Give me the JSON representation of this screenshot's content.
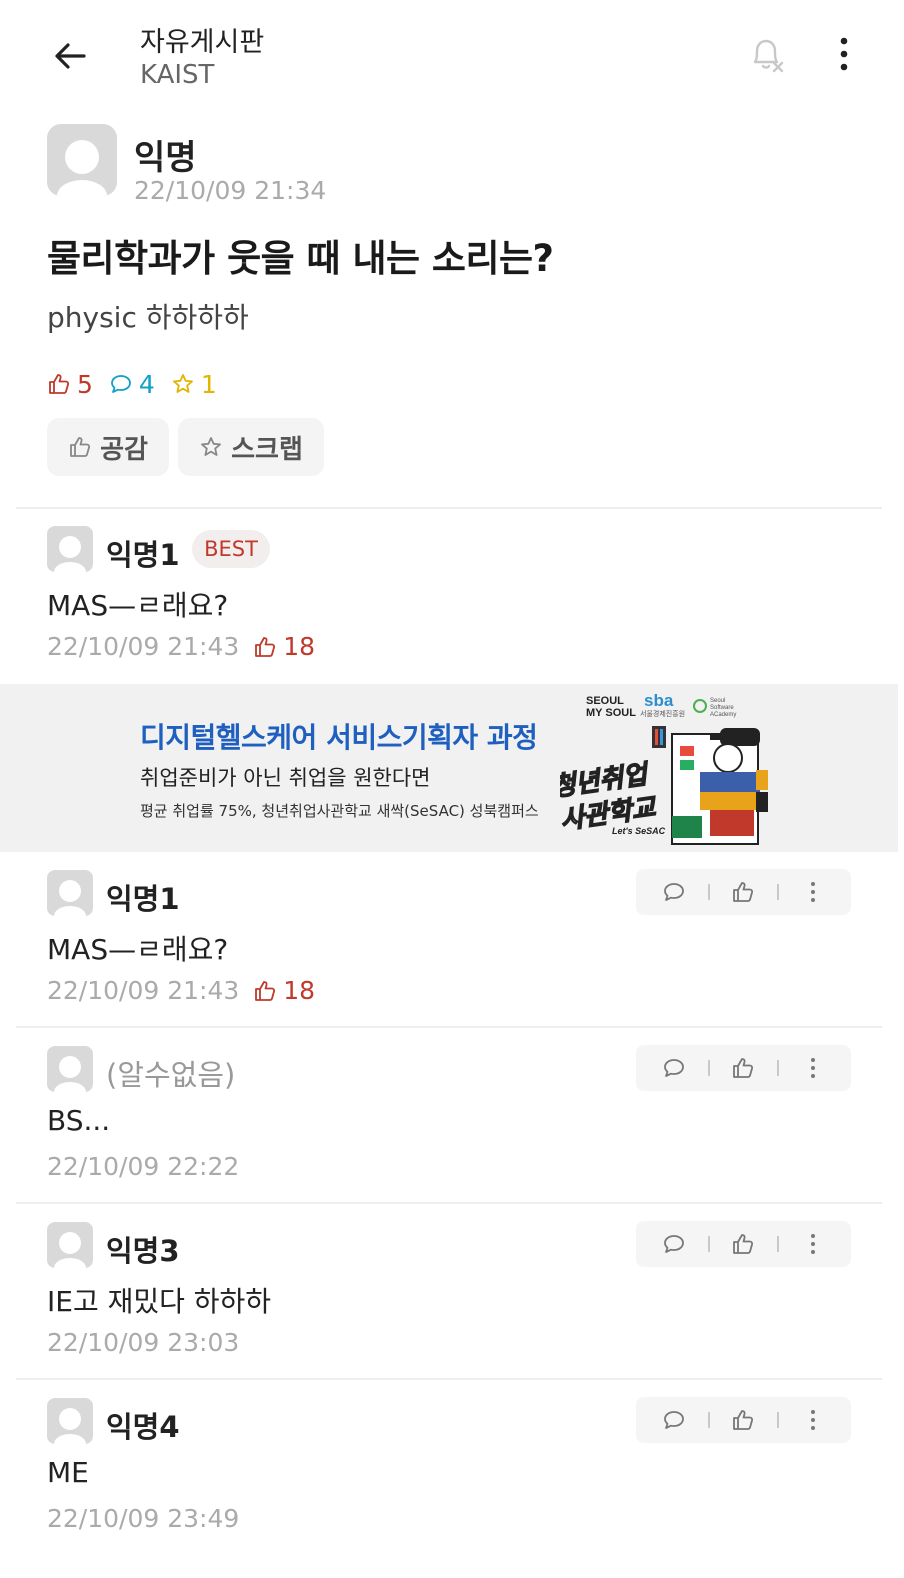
{
  "header": {
    "board_title": "자유게시판",
    "board_subtitle": "KAIST"
  },
  "post": {
    "author": "익명",
    "timestamp": "22/10/09 21:34",
    "title": "물리학과가 웃을 때 내는 소리는?",
    "body": "physic 하하하하",
    "stats": {
      "likes": "5",
      "comments": "4",
      "scraps": "1"
    },
    "like_button_label": "공감",
    "scrap_button_label": "스크랩"
  },
  "best_comment": {
    "author": "익명1",
    "badge": "BEST",
    "body": "MAS—ㄹ래요?",
    "timestamp": "22/10/09 21:43",
    "likes": "18"
  },
  "ad": {
    "title": "디지털헬스케어 서비스기획자 과정",
    "subtitle": "취업준비가 아닌 취업을 원한다면",
    "small": "평균 취업률 75%, 청년취업사관학교 새싹(SeSAC) 성북캠퍼스",
    "logo_1_line1": "SEOUL",
    "logo_1_line2": "MY SOUL",
    "logo_2": "sba",
    "logo_2_sub": "서울경제진흥원",
    "logo_3_line1": "Seoul",
    "logo_3_line2": "Software",
    "logo_3_line3": "ACademy",
    "art_text_1": "청년취업",
    "art_text_2": "사관학교",
    "art_text_3": "Let's SeSAC"
  },
  "comments": [
    {
      "author": "익명1",
      "body": "MAS—ㄹ래요?",
      "timestamp": "22/10/09 21:43",
      "likes": "18"
    },
    {
      "author": "(알수없음)",
      "body": "BS...",
      "timestamp": "22/10/09 22:22"
    },
    {
      "author": "익명3",
      "body": "IE고 재밌다 하하하",
      "timestamp": "22/10/09 23:03"
    },
    {
      "author": "익명4",
      "body": "ME",
      "timestamp": "22/10/09 23:49"
    }
  ],
  "colors": {
    "like_red": "#c0392b",
    "comment_cyan": "#11a0c8",
    "scrap_yellow": "#e2b500",
    "ad_blue": "#1f5fbf"
  }
}
